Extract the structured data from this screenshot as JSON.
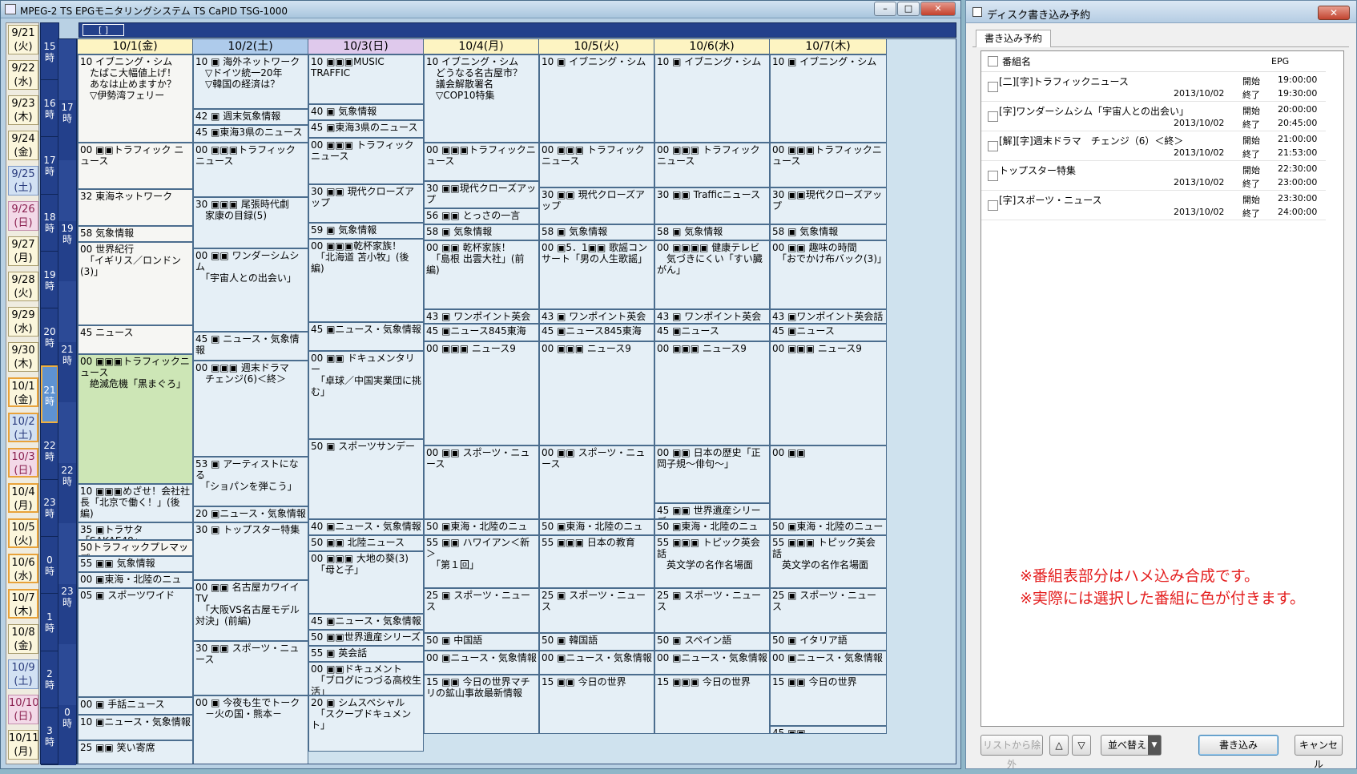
{
  "window": {
    "title": "MPEG-2 TS EPGモニタリングシステム TS CaPID TSG-1000",
    "controls": [
      "–",
      "□",
      "✕"
    ]
  },
  "dates": [
    "9/21\n(火)",
    "9/22\n(水)",
    "9/23\n(木)",
    "9/24\n(金)",
    "9/25\n(土)",
    "9/26\n(日)",
    "9/27\n(月)",
    "9/28\n(火)",
    "9/29\n(水)",
    "9/30\n(木)",
    "10/1\n(金)",
    "10/2\n(土)",
    "10/3\n(日)",
    "10/4\n(月)",
    "10/5\n(火)",
    "10/6\n(水)",
    "10/7\n(木)",
    "10/8\n(金)",
    "10/9\n(土)",
    "10/10\n(日)",
    "10/11\n(月)"
  ],
  "hours_left": [
    "15\n時",
    "16\n時",
    "17\n時",
    "18\n時",
    "19\n時",
    "20\n時",
    "21\n時",
    "22\n時",
    "23\n時",
    "0\n時",
    "1\n時",
    "2\n時",
    "3\n時"
  ],
  "hours_inner": [
    "",
    "17\n時",
    "",
    "19\n時",
    "",
    "21\n時",
    "",
    "22\n時",
    "",
    "23\n時",
    "",
    "0\n時"
  ],
  "topbar": {
    "label": "[ ]"
  },
  "columns": [
    {
      "date": "10/1(金)",
      "type": "wk"
    },
    {
      "date": "10/2(土)",
      "type": "sat"
    },
    {
      "date": "10/3(日)",
      "type": "sun"
    },
    {
      "date": "10/4(月)",
      "type": "wk"
    },
    {
      "date": "10/5(火)",
      "type": "wk"
    },
    {
      "date": "10/6(水)",
      "type": "wk"
    },
    {
      "date": "10/7(木)",
      "type": "wk"
    }
  ],
  "programs": [
    [
      {
        "t": "10 イブニング・シム\n　たばこ大幅値上げ！\n　あなは止めますか？\n　▽伊勢湾フェリー",
        "h": 110,
        "c": "wh"
      },
      {
        "t": "00 ▣▣トラフィック ニュース",
        "h": 58,
        "c": "wh"
      },
      {
        "t": "32 東海ネットワーク",
        "h": 46,
        "c": "wh"
      },
      {
        "t": "58 気象情報",
        "h": 20,
        "c": "wh"
      },
      {
        "t": "00 世界紀行\n　「イギリス／ロンドン(3)」",
        "h": 104,
        "c": "wh"
      },
      {
        "t": "45 ニュース",
        "h": 36,
        "c": "wh"
      },
      {
        "t": "00 ▣▣▣トラフィックニュース\n　絶滅危機「黒まぐろ」",
        "h": 162,
        "c": "hl"
      },
      {
        "t": "10 ▣▣▣めざせ！会社社長「北京で働く！」(後編)",
        "h": 48,
        "c": ""
      },
      {
        "t": "35 ▣トラサタ「SAKAE48」",
        "h": 22,
        "c": ""
      },
      {
        "t": "50トラフィックプレマップ",
        "h": 20,
        "c": "wh"
      },
      {
        "t": "55 ▣▣ 気象情報",
        "h": 20,
        "c": ""
      },
      {
        "t": "00 ▣東海・北陸のニュー",
        "h": 20,
        "c": ""
      },
      {
        "t": "05 ▣ スポーツワイド",
        "h": 136,
        "c": ""
      },
      {
        "t": "00 ▣ 手話ニュース",
        "h": 22,
        "c": ""
      },
      {
        "t": "10 ▣ニュース・気象情報",
        "h": 32,
        "c": ""
      },
      {
        "t": "25 ▣▣ 笑い寄席",
        "h": 60,
        "c": ""
      }
    ],
    [
      {
        "t": "10 ▣ 海外ネットワーク\n　▽ドイツ統一20年\n　▽韓国の経済は？",
        "h": 68,
        "c": ""
      },
      {
        "t": "42 ▣ 週末気象情報",
        "h": 20,
        "c": ""
      },
      {
        "t": "45 ▣東海3県のニュース",
        "h": 22,
        "c": ""
      },
      {
        "t": "00 ▣▣▣トラフィック ニュース",
        "h": 68,
        "c": ""
      },
      {
        "t": "30 ▣▣▣ 尾張時代劇\n　家康の目録(5)",
        "h": 64,
        "c": ""
      },
      {
        "t": "00 ▣▣ ワンダーシムシム\n　「宇宙人との出会い」",
        "h": 104,
        "c": ""
      },
      {
        "t": "45 ▣ ニュース・気象情報",
        "h": 36,
        "c": ""
      },
      {
        "t": "00 ▣▣▣ 週末ドラマ\n　チェンジ(6)＜終＞",
        "h": 120,
        "c": ""
      },
      {
        "t": "53 ▣ アーティストになる\n　「ショパンを弾こう」",
        "h": 62,
        "c": ""
      },
      {
        "t": "20 ▣ニュース・気象情報",
        "h": 20,
        "c": ""
      },
      {
        "t": "30 ▣ トップスター特集",
        "h": 72,
        "c": ""
      },
      {
        "t": "00 ▣▣ 名古屋カワイイTV\n　「大阪VS名古屋モデル対決」(前編)",
        "h": 76,
        "c": ""
      },
      {
        "t": "30 ▣▣ スポーツ・ニュース",
        "h": 68,
        "c": ""
      },
      {
        "t": "00 ▣ 今夜も生でトーク\n　－火の国・熊本－",
        "h": 112,
        "c": ""
      }
    ],
    [
      {
        "t": "10 ▣▣▣MUSIC TRAFFIC",
        "h": 62,
        "c": ""
      },
      {
        "t": "40 ▣ 気象情報",
        "h": 20,
        "c": ""
      },
      {
        "t": "45 ▣東海3県のニュース",
        "h": 22,
        "c": ""
      },
      {
        "t": "00 ▣▣▣ トラフィックニュース",
        "h": 58,
        "c": ""
      },
      {
        "t": "30 ▣▣ 現代クローズアップ",
        "h": 48,
        "c": ""
      },
      {
        "t": "59 ▣ 気象情報",
        "h": 20,
        "c": ""
      },
      {
        "t": "00 ▣▣▣乾杯家族！\n　「北海道 苫小牧」(後編)",
        "h": 104,
        "c": ""
      },
      {
        "t": "45 ▣ニュース・気象情報",
        "h": 36,
        "c": ""
      },
      {
        "t": "00 ▣▣ ドキュメンタリー\n　「卓球／中国実業団に挑む」",
        "h": 110,
        "c": ""
      },
      {
        "t": "50 ▣ スポーツサンデー",
        "h": 100,
        "c": ""
      },
      {
        "t": "40 ▣ニュース・気象情報",
        "h": 20,
        "c": ""
      },
      {
        "t": "50 ▣▣ 北陸ニュース",
        "h": 20,
        "c": ""
      },
      {
        "t": "00 ▣▣▣ 大地の葵(3)\n　「母と子」",
        "h": 78,
        "c": ""
      },
      {
        "t": "45 ▣ニュース・気象情報",
        "h": 20,
        "c": ""
      },
      {
        "t": "50 ▣▣世界遺産シリーズ",
        "h": 20,
        "c": ""
      },
      {
        "t": "55 ▣ 英会話",
        "h": 20,
        "c": ""
      },
      {
        "t": "00 ▣▣ドキュメント\n　「ブログにつづる高校生活」",
        "h": 42,
        "c": ""
      },
      {
        "t": "20 ▣ シムスペシャル\n　「スクープドキュメント」",
        "h": 70,
        "c": ""
      }
    ],
    [
      {
        "t": "10 イブニング・シム\n　どうなる名古屋市？\n　議会解散署名\n　▽COP10特集",
        "h": 110,
        "c": ""
      },
      {
        "t": "00 ▣▣▣トラフィックニュース",
        "h": 48,
        "c": ""
      },
      {
        "t": "30 ▣▣現代クローズアップ",
        "h": 34,
        "c": ""
      },
      {
        "t": "56 ▣▣ とっさの一言",
        "h": 20,
        "c": ""
      },
      {
        "t": "58 ▣ 気象情報",
        "h": 20,
        "c": ""
      },
      {
        "t": "00 ▣▣ 乾杯家族！\n　「島根 出雲大社」(前編)",
        "h": 86,
        "c": ""
      },
      {
        "t": "43 ▣ ワンポイント英会話",
        "h": 18,
        "c": ""
      },
      {
        "t": "45 ▣ニュース845東海",
        "h": 22,
        "c": ""
      },
      {
        "t": "00 ▣▣▣ ニュース9",
        "h": 130,
        "c": ""
      },
      {
        "t": "00 ▣▣ スポーツ・ニュース",
        "h": 92,
        "c": ""
      },
      {
        "t": "50 ▣東海・北陸のニュー",
        "h": 20,
        "c": ""
      },
      {
        "t": "55 ▣▣ ハワイアン＜新＞\n　「第１回」",
        "h": 66,
        "c": ""
      },
      {
        "t": "25 ▣ スポーツ・ニュース",
        "h": 56,
        "c": ""
      },
      {
        "t": "50 ▣ 中国語",
        "h": 22,
        "c": ""
      },
      {
        "t": "00 ▣ニュース・気象情報",
        "h": 30,
        "c": ""
      },
      {
        "t": "15 ▣▣ 今日の世界マチリの鉱山事故最新情報",
        "h": 74,
        "c": ""
      }
    ],
    [
      {
        "t": "10 ▣ イブニング・シム",
        "h": 110,
        "c": ""
      },
      {
        "t": "00 ▣▣▣ トラフィックニュース",
        "h": 56,
        "c": ""
      },
      {
        "t": "30 ▣▣ 現代クローズアップ",
        "h": 46,
        "c": ""
      },
      {
        "t": "58 ▣ 気象情報",
        "h": 20,
        "c": ""
      },
      {
        "t": "00 ▣5．1▣▣ 歌謡コンサート「男の人生歌謡」",
        "h": 86,
        "c": ""
      },
      {
        "t": "43 ▣ ワンポイント英会話",
        "h": 18,
        "c": ""
      },
      {
        "t": "45 ▣ニュース845東海",
        "h": 22,
        "c": ""
      },
      {
        "t": "00 ▣▣▣ ニュース9",
        "h": 130,
        "c": ""
      },
      {
        "t": "00 ▣▣ スポーツ・ニュース",
        "h": 92,
        "c": ""
      },
      {
        "t": "50 ▣東海・北陸のニュー",
        "h": 20,
        "c": ""
      },
      {
        "t": "55 ▣▣▣ 日本の教育",
        "h": 66,
        "c": ""
      },
      {
        "t": "25 ▣ スポーツ・ニュース",
        "h": 56,
        "c": ""
      },
      {
        "t": "50 ▣ 韓国語",
        "h": 22,
        "c": ""
      },
      {
        "t": "00 ▣ニュース・気象情報",
        "h": 30,
        "c": ""
      },
      {
        "t": "15 ▣▣ 今日の世界",
        "h": 74,
        "c": ""
      }
    ],
    [
      {
        "t": "10 ▣ イブニング・シム",
        "h": 110,
        "c": ""
      },
      {
        "t": "00 ▣▣▣ トラフィックニュース",
        "h": 56,
        "c": ""
      },
      {
        "t": "30 ▣▣ Trafficニュース",
        "h": 46,
        "c": ""
      },
      {
        "t": "58 ▣ 気象情報",
        "h": 20,
        "c": ""
      },
      {
        "t": "00 ▣▣▣▣ 健康テレビ\n　気づきにくい「すい臓がん」",
        "h": 86,
        "c": ""
      },
      {
        "t": "43 ▣ ワンポイント英会話",
        "h": 18,
        "c": ""
      },
      {
        "t": "45 ▣ニュース",
        "h": 22,
        "c": ""
      },
      {
        "t": "00 ▣▣▣ ニュース9",
        "h": 130,
        "c": ""
      },
      {
        "t": "00 ▣▣ 日本の歴史「正岡子規～俳句～」",
        "h": 72,
        "c": ""
      },
      {
        "t": "45 ▣▣ 世界遺産シリーズ",
        "h": 20,
        "c": ""
      },
      {
        "t": "50 ▣東海・北陸のニュー",
        "h": 20,
        "c": ""
      },
      {
        "t": "55 ▣▣▣ トピック英会話\n　英文学の名作名場面",
        "h": 66,
        "c": ""
      },
      {
        "t": "25 ▣ スポーツ・ニュース",
        "h": 56,
        "c": ""
      },
      {
        "t": "50 ▣ スペイン語",
        "h": 22,
        "c": ""
      },
      {
        "t": "00 ▣ニュース・気象情報",
        "h": 30,
        "c": ""
      },
      {
        "t": "15 ▣▣▣ 今日の世界",
        "h": 74,
        "c": ""
      }
    ],
    [
      {
        "t": "10 ▣ イブニング・シム",
        "h": 110,
        "c": ""
      },
      {
        "t": "00 ▣▣▣トラフィックニュース",
        "h": 56,
        "c": ""
      },
      {
        "t": "30 ▣▣現代クローズアップ",
        "h": 46,
        "c": ""
      },
      {
        "t": "58 ▣ 気象情報",
        "h": 20,
        "c": ""
      },
      {
        "t": "00 ▣▣ 趣味の時間\n　「おでかけ布バック(3)」",
        "h": 86,
        "c": ""
      },
      {
        "t": "43 ▣ワンポイント英会話",
        "h": 18,
        "c": ""
      },
      {
        "t": "45 ▣ニュース",
        "h": 22,
        "c": ""
      },
      {
        "t": "00 ▣▣▣ ニュース9",
        "h": 130,
        "c": ""
      },
      {
        "t": "00 ▣▣",
        "h": 92,
        "c": ""
      },
      {
        "t": "50 ▣東海・北陸のニュー",
        "h": 20,
        "c": ""
      },
      {
        "t": "55 ▣▣▣ トピック英会話\n　英文学の名作名場面",
        "h": 66,
        "c": ""
      },
      {
        "t": "25 ▣ スポーツ・ニュース",
        "h": 56,
        "c": ""
      },
      {
        "t": "50 ▣ イタリア語",
        "h": 22,
        "c": ""
      },
      {
        "t": "00 ▣ニュース・気象情報",
        "h": 30,
        "c": ""
      },
      {
        "t": "15 ▣▣ 今日の世界",
        "h": 64,
        "c": ""
      },
      {
        "t": "45 ▣▣",
        "h": 10,
        "c": ""
      }
    ]
  ],
  "panel": {
    "title": "ディスク書き込み予約",
    "close": "✕",
    "tab": "書き込み予約",
    "headers": {
      "name": "番組名",
      "epg": "EPG"
    },
    "reservations": [
      {
        "name": "[二][字]トラフィックニュース",
        "date": "2013/10/02",
        "start_label": "開始",
        "end_label": "終了",
        "start": "19:00:00",
        "end": "19:30:00"
      },
      {
        "name": "[字]ワンダーシムシム「宇宙人との出会い」",
        "date": "2013/10/02",
        "start_label": "開始",
        "end_label": "終了",
        "start": "20:00:00",
        "end": "20:45:00"
      },
      {
        "name": "[解][字]週末ドラマ　チェンジ（6）＜終＞",
        "date": "2013/10/02",
        "start_label": "開始",
        "end_label": "終了",
        "start": "21:00:00",
        "end": "21:53:00"
      },
      {
        "name": "トップスター特集",
        "date": "2013/10/02",
        "start_label": "開始",
        "end_label": "終了",
        "start": "22:30:00",
        "end": "23:00:00"
      },
      {
        "name": "[字]スポーツ・ニュース",
        "date": "2013/10/02",
        "start_label": "開始",
        "end_label": "終了",
        "start": "23:30:00",
        "end": "24:00:00"
      }
    ],
    "note1": "※番組表部分はハメ込み合成です。",
    "note2": "※実際には選択した番組に色が付きます。",
    "buttons": {
      "remove": "リストから除外",
      "up": "△",
      "down": "▽",
      "sort": "並べ替え",
      "write": "書き込み",
      "cancel": "キャンセル"
    }
  },
  "colors": {
    "accent": "#23408b",
    "highlight": "#cde6b6",
    "note": "#e41f1f"
  }
}
